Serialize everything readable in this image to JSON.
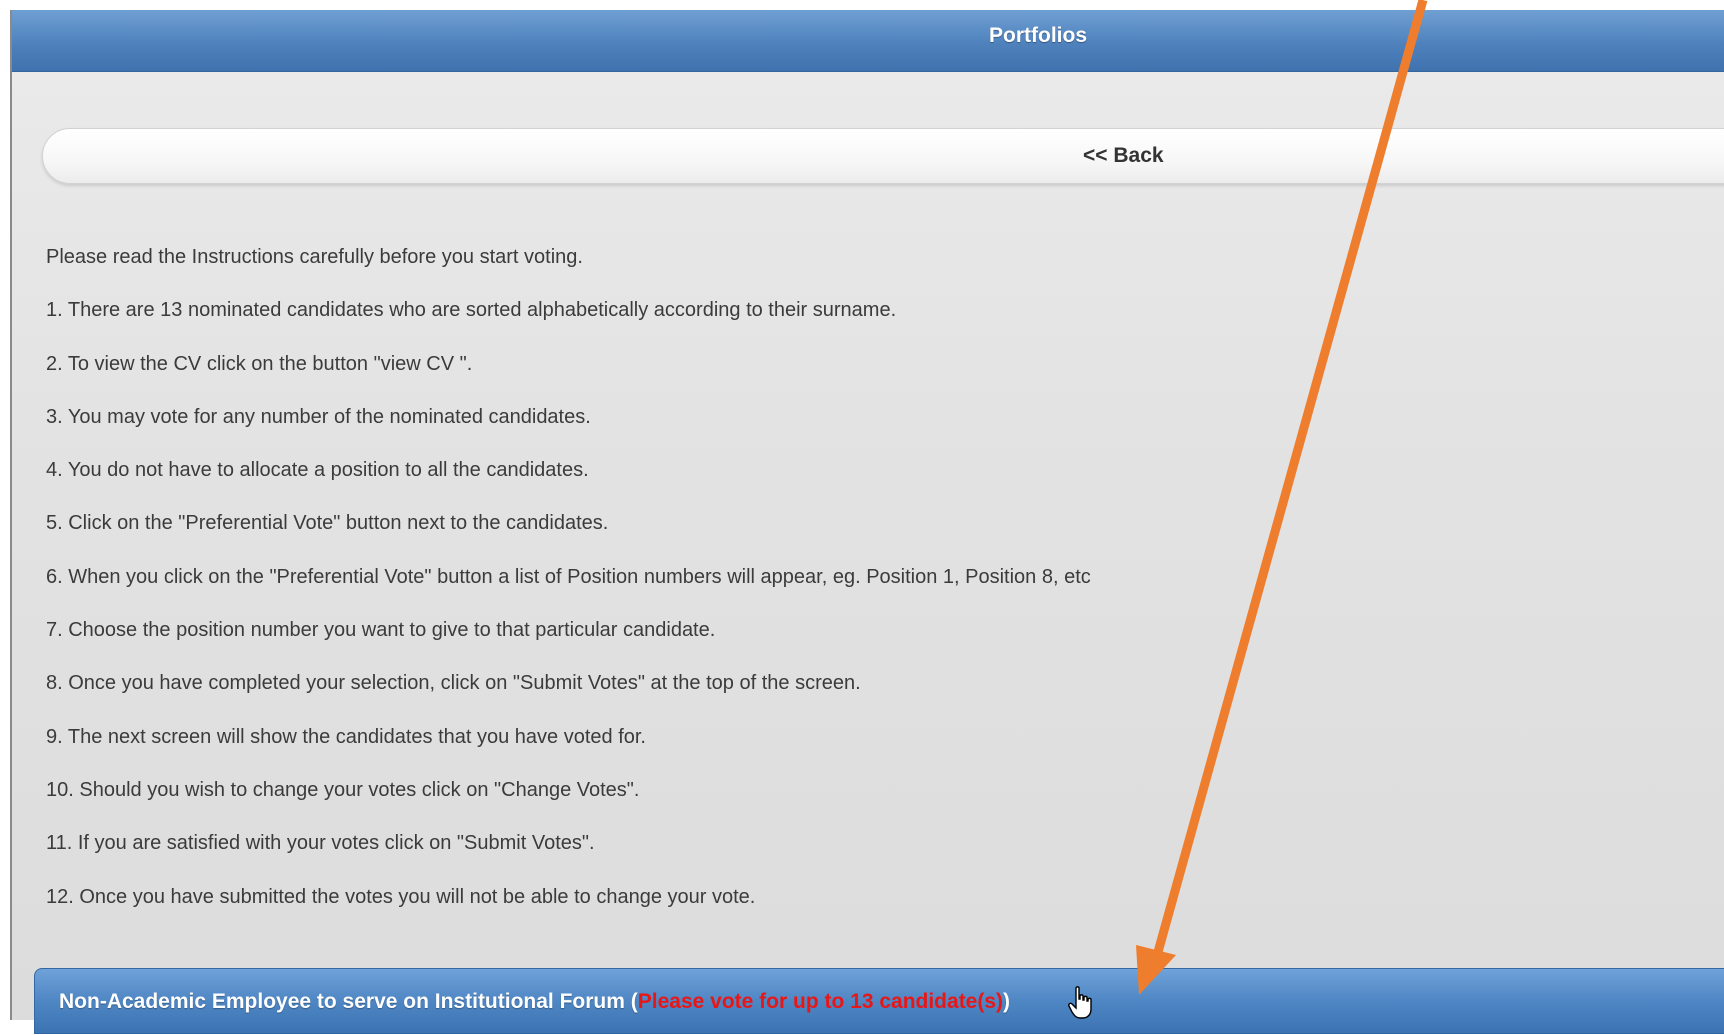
{
  "header": {
    "title": "Portfolios"
  },
  "back_button": {
    "label": "<< Back"
  },
  "instructions": {
    "lines": [
      "Please read the Instructions carefully before you start voting.",
      "1. There are 13 nominated candidates who are sorted alphabetically according to their surname.",
      "2. To view the CV click on the button \"view  CV \".",
      "3. You may vote for any number of the nominated candidates.",
      "4. You do not have to allocate a position to all the candidates.",
      "5. Click on the \"Preferential Vote\" button next to the candidates.",
      "6. When you click on the \"Preferential Vote\" button a list of Position numbers will appear, eg. Position 1, Position 8, etc",
      "7. Choose the position number you want to give to that particular candidate.",
      "8. Once you have completed your selection, click on \"Submit Votes\" at the top of the screen.",
      "9. The next screen will show the candidates that you have voted for.",
      "10. Should you wish to change your votes click on \"Change Votes\".",
      "11. If you are satisfied with your votes click on \"Submit Votes\".",
      "12. Once you have submitted the votes you will not be able to change your vote."
    ]
  },
  "section": {
    "title": "Non-Academic Employee to serve on Institutional Forum",
    "open_paren": " (",
    "note": "Please vote for up to 13 candidate(s)",
    "close_paren": ")"
  },
  "icons": {
    "annotation_arrow": "arrow-annotation-icon",
    "cursor": "hand-pointer-cursor-icon"
  },
  "colors": {
    "header_blue": "#4f82bd",
    "note_red": "#e81717",
    "annotation_orange": "#ef7d2e"
  }
}
